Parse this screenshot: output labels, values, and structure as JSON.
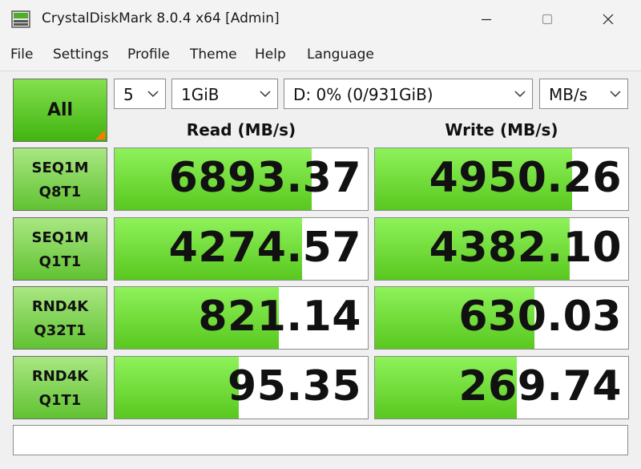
{
  "window": {
    "title": "CrystalDiskMark 8.0.4 x64 [Admin]"
  },
  "menu": [
    "File",
    "Settings",
    "Profile",
    "Theme",
    "Help",
    "Language"
  ],
  "controls": {
    "all_label": "All",
    "count": "5",
    "size": "1GiB",
    "drive": "D: 0% (0/931GiB)",
    "unit": "MB/s"
  },
  "headers": {
    "read": "Read (MB/s)",
    "write": "Write (MB/s)"
  },
  "tests": [
    {
      "line1": "SEQ1M",
      "line2": "Q8T1",
      "read": "6893.37",
      "write": "4950.26",
      "read_fill": 0.78,
      "write_fill": 0.78
    },
    {
      "line1": "SEQ1M",
      "line2": "Q1T1",
      "read": "4274.57",
      "write": "4382.10",
      "read_fill": 0.74,
      "write_fill": 0.77
    },
    {
      "line1": "RND4K",
      "line2": "Q32T1",
      "read": "821.14",
      "write": "630.03",
      "read_fill": 0.65,
      "write_fill": 0.63
    },
    {
      "line1": "RND4K",
      "line2": "Q1T1",
      "read": "95.35",
      "write": "269.74",
      "read_fill": 0.49,
      "write_fill": 0.56
    }
  ],
  "comment": ""
}
